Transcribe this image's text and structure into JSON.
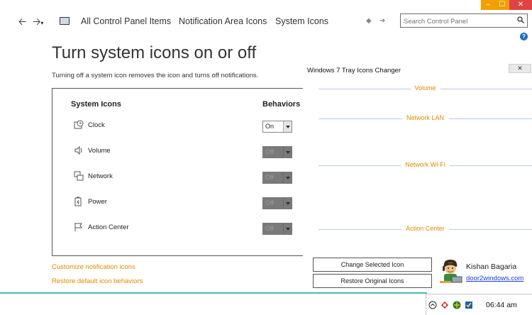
{
  "window_controls": {
    "minimize": "–",
    "maximize": "☐",
    "close": "✕"
  },
  "nav": {
    "breadcrumbs": [
      "All Control Panel Items",
      "Notification Area Icons",
      "System Icons"
    ],
    "search_placeholder": "Search Control Panel"
  },
  "page": {
    "title": "Turn system icons on or off",
    "description": "Turning off a system icon removes the icon and turns off notifications."
  },
  "table": {
    "col_system_icons": "System Icons",
    "col_behaviors": "Behaviors",
    "rows": [
      {
        "label": "Clock",
        "value": "On",
        "enabled": true,
        "icon": "clock-icon"
      },
      {
        "label": "Volume",
        "value": "Off",
        "enabled": false,
        "icon": "volume-icon"
      },
      {
        "label": "Network",
        "value": "Off",
        "enabled": false,
        "icon": "network-icon"
      },
      {
        "label": "Power",
        "value": "Off",
        "enabled": false,
        "icon": "power-icon"
      },
      {
        "label": "Action Center",
        "value": "Off",
        "enabled": false,
        "icon": "flag-icon"
      }
    ]
  },
  "links": {
    "customize": "Customize notification icons",
    "restore_defaults": "Restore default icon behaviors"
  },
  "tool": {
    "title": "Windows 7 Tray Icons Changer",
    "sections": [
      "Volume",
      "Network LAN",
      "Network Wi-Fi",
      "Action Center"
    ],
    "change_button": "Change Selected Icon",
    "restore_button": "Restore Original Icons",
    "author": "Kishan Bagaria",
    "author_link": "door2windows.com"
  },
  "taskbar": {
    "time": "06:44 am"
  },
  "colors": {
    "accent_orange": "#e08a00",
    "link_blue": "#1a3fd8",
    "close_red": "#e04343",
    "taskbar_line": "#49b7b3"
  }
}
